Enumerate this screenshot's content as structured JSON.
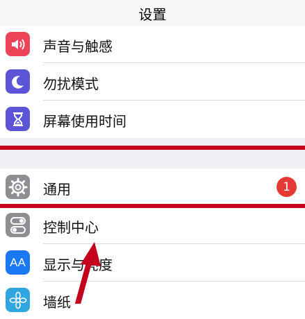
{
  "header": {
    "title": "设置"
  },
  "group1": [
    {
      "label": "声音与触感",
      "icon": "speaker-icon",
      "color": "#ec4356"
    },
    {
      "label": "勿扰模式",
      "icon": "moon-icon",
      "color": "#5b54d6"
    },
    {
      "label": "屏幕使用时间",
      "icon": "hourglass-icon",
      "color": "#5b54d6"
    }
  ],
  "group2": [
    {
      "label": "通用",
      "icon": "gear-icon",
      "color": "#8e8e93",
      "badge": "1"
    },
    {
      "label": "控制中心",
      "icon": "toggle-icon",
      "color": "#8e8e93"
    },
    {
      "label": "显示与亮度",
      "icon": "text-size-icon",
      "color": "#1a78f2",
      "icon_text": "AA"
    },
    {
      "label": "墙纸",
      "icon": "flower-icon",
      "color": "#2fa6e0"
    }
  ],
  "colors": {
    "highlight": "#c4001c",
    "badge": "#e53935",
    "background": "#efeff4"
  }
}
